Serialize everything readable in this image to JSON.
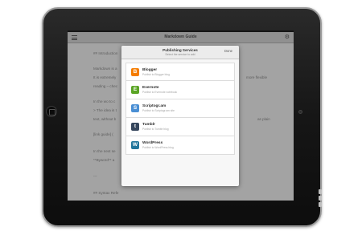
{
  "app": {
    "title": "Markdown Guide"
  },
  "document_lines": [
    "## Introduction",
    "Markdown is a",
    "It is extremely",
    "reading – chec",
    "In the wo to c",
    "> The idea is t",
    "text, without b",
    "[link guide] (",
    "In the next se",
    "**Byword** a",
    "---",
    "## Syntax Refe"
  ],
  "document_line_tails": {
    "2": "more flexible",
    "6": "as plain"
  },
  "modal": {
    "title": "Publishing Services",
    "subtitle": "Select the service to add",
    "done_label": "Done",
    "services": [
      {
        "name": "Blogger",
        "description": "Publish to Blogger blog",
        "icon": "blogger-icon",
        "glyph": "B",
        "color": "#f57d00"
      },
      {
        "name": "Evernote",
        "description": "Publish to Evernote notebook",
        "icon": "evernote-icon",
        "glyph": "E",
        "color": "#5ba525"
      },
      {
        "name": "Scriptogr.am",
        "description": "Publish to Scriptogr.am site",
        "icon": "scriptogram-icon",
        "glyph": "S",
        "color": "#4a8fd4"
      },
      {
        "name": "Tumblr",
        "description": "Publish to Tumblr blog",
        "icon": "tumblr-icon",
        "glyph": "t",
        "color": "#35465c"
      },
      {
        "name": "WordPress",
        "description": "Publish to WordPress blog",
        "icon": "wordpress-icon",
        "glyph": "W",
        "color": "#21759b"
      }
    ]
  }
}
